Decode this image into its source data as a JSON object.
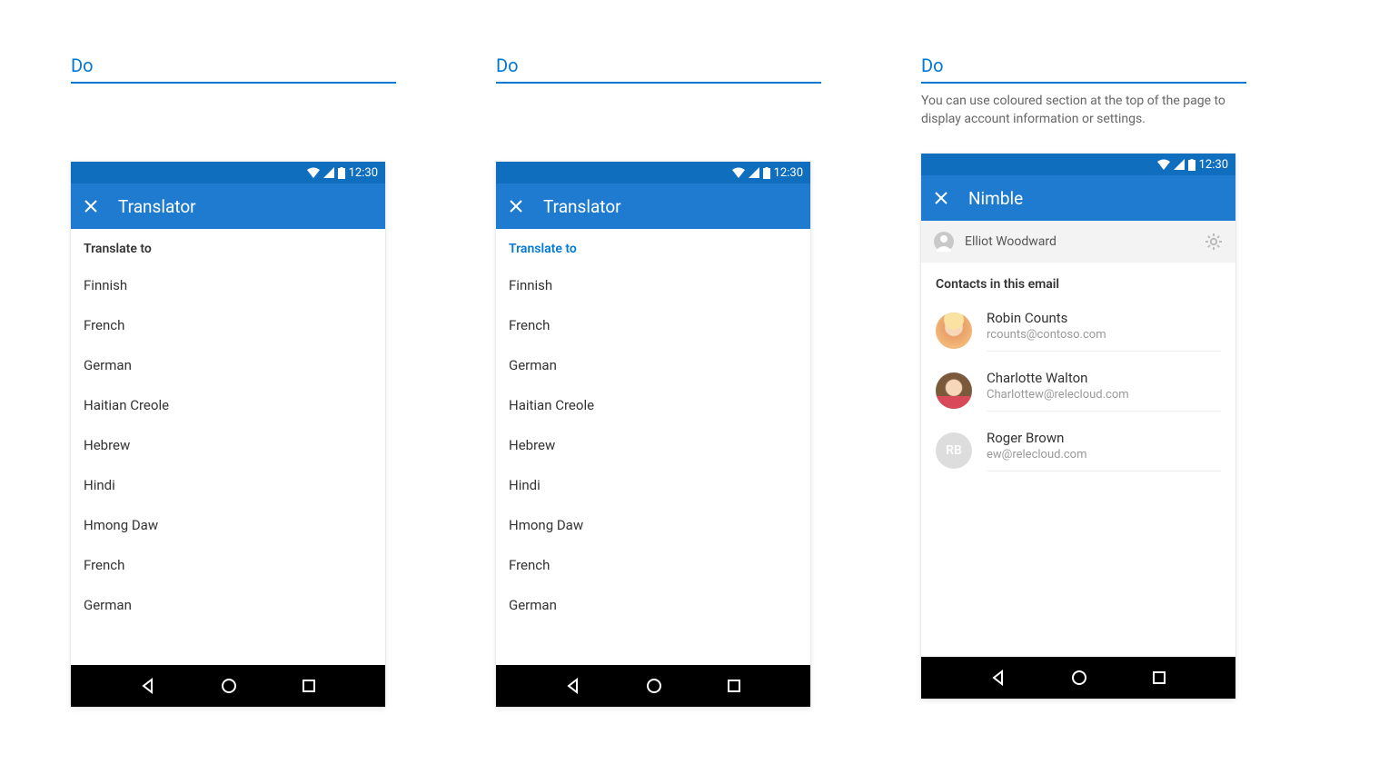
{
  "labels": {
    "do": "Do"
  },
  "statusbar": {
    "time": "12:30"
  },
  "panel1": {
    "title": "Translator",
    "header": "Translate to",
    "items": [
      "Finnish",
      "French",
      "German",
      "Haitian Creole",
      "Hebrew",
      "Hindi",
      "Hmong Daw",
      "French",
      "German"
    ]
  },
  "panel2": {
    "title": "Translator",
    "header": "Translate to",
    "items": [
      "Finnish",
      "French",
      "German",
      "Haitian Creole",
      "Hebrew",
      "Hindi",
      "Hmong Daw",
      "French",
      "German"
    ]
  },
  "panel3": {
    "caption": "You can use coloured section at the top of the page to display account information or settings.",
    "title": "Nimble",
    "account_name": "Elliot Woodward",
    "contacts_header": "Contacts in this email",
    "contacts": [
      {
        "name": "Robin Counts",
        "email": "rcounts@contoso.com",
        "initials": ""
      },
      {
        "name": "Charlotte Walton",
        "email": "Charlottew@relecloud.com",
        "initials": ""
      },
      {
        "name": "Roger Brown",
        "email": "ew@relecloud.com",
        "initials": "RB"
      }
    ]
  }
}
